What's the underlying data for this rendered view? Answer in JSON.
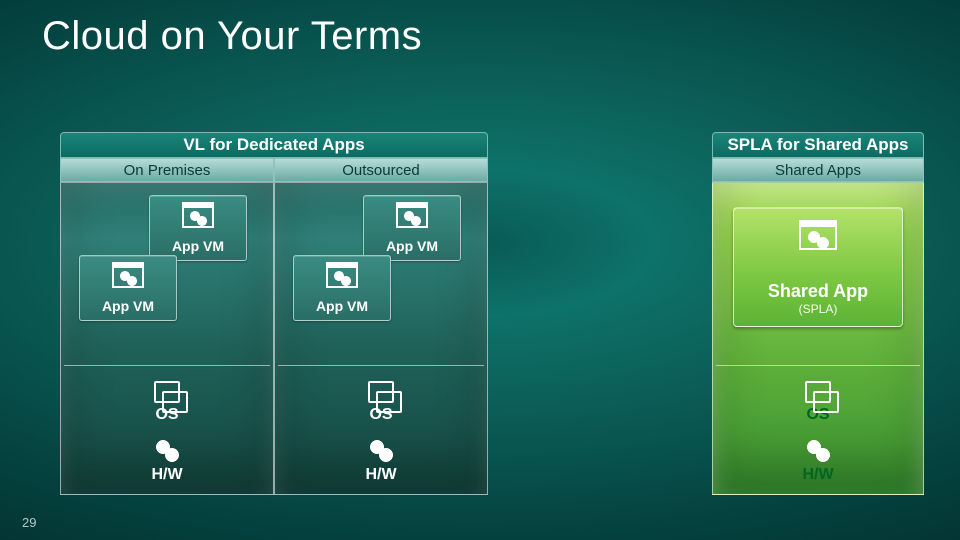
{
  "title": "Cloud on Your Terms",
  "slide_number": "29",
  "groups": {
    "left": {
      "header": "VL for Dedicated Apps"
    },
    "right": {
      "header": "SPLA for Shared Apps"
    }
  },
  "columns": {
    "on_premises": {
      "header": "On Premises",
      "app_vm_label": "App VM",
      "os_label": "OS",
      "hw_label": "H/W"
    },
    "outsourced": {
      "header": "Outsourced",
      "app_vm_label": "App VM",
      "os_label": "OS",
      "hw_label": "H/W"
    },
    "shared_apps": {
      "header": "Shared Apps",
      "shared_app_label": "Shared App",
      "shared_app_sublabel": "(SPLA)",
      "os_label": "OS",
      "hw_label": "H/W"
    }
  }
}
